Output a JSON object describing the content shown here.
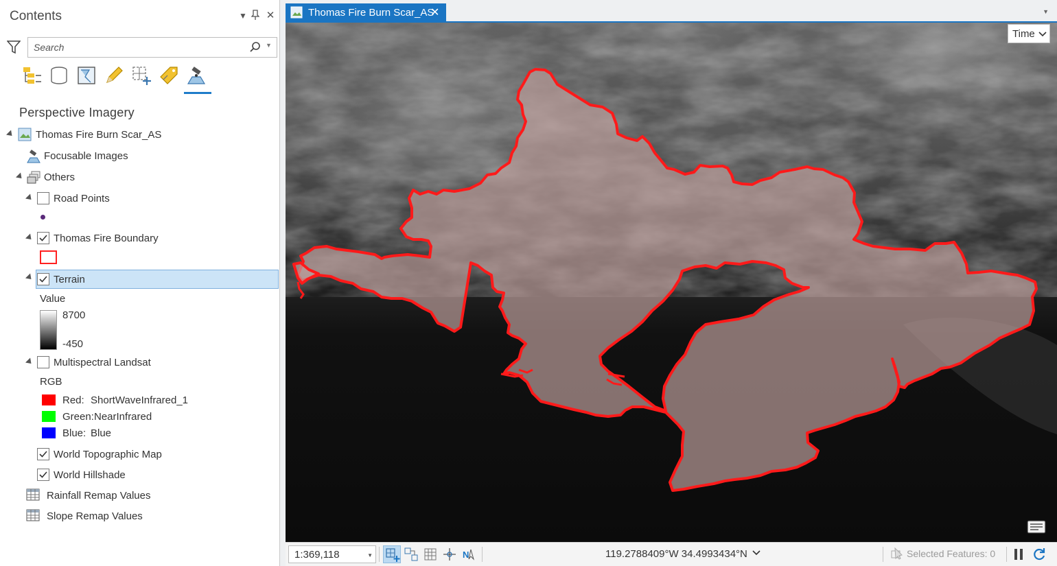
{
  "contents": {
    "title": "Contents",
    "search_placeholder": "Search",
    "toc_title": "Perspective Imagery",
    "toolbar": [
      "list-by-drawing-order-icon",
      "list-by-data-source-icon",
      "list-by-selection-icon",
      "list-by-editing-icon",
      "list-by-snapping-icon",
      "list-by-labeling-icon",
      "list-by-perspective-imagery-icon"
    ],
    "items": {
      "map": "Thomas Fire Burn Scar_AS",
      "focusable": "Focusable Images",
      "others": "Others",
      "road_points": "Road Points",
      "thomas_boundary": "Thomas Fire Boundary",
      "terrain": "Terrain",
      "value_label": "Value",
      "value_high": "8700",
      "value_low": "-450",
      "multispectral": "Multispectral Landsat",
      "rgb_label": "RGB",
      "red_label": "Red:",
      "red_value": "ShortWaveInfrared_1",
      "green_label": "Green:",
      "green_value": "NearInfrared",
      "blue_label": "Blue:",
      "blue_value": "Blue",
      "world_topo": "World Topographic Map",
      "world_hillshade": "World Hillshade",
      "rainfall": "Rainfall Remap Values",
      "slope": "Slope Remap Values"
    },
    "checked": {
      "road_points": false,
      "thomas_boundary": true,
      "terrain": true,
      "multispectral": false,
      "world_topo": true,
      "world_hillshade": true
    },
    "colors": {
      "red": "#ff0000",
      "green": "#00ff00",
      "blue": "#0000ff",
      "boundary": "#ff2020",
      "point": "#5a2a7a",
      "selection": "#cce4f7"
    }
  },
  "map_view": {
    "tab_label": "Thomas Fire Burn Scar_AS",
    "time_button": "Time",
    "scale": "1:369,118",
    "coordinates": "119.2788409°W 34.4993434°N",
    "selected_features": "Selected Features: 0",
    "accent": "#1a75c3"
  }
}
